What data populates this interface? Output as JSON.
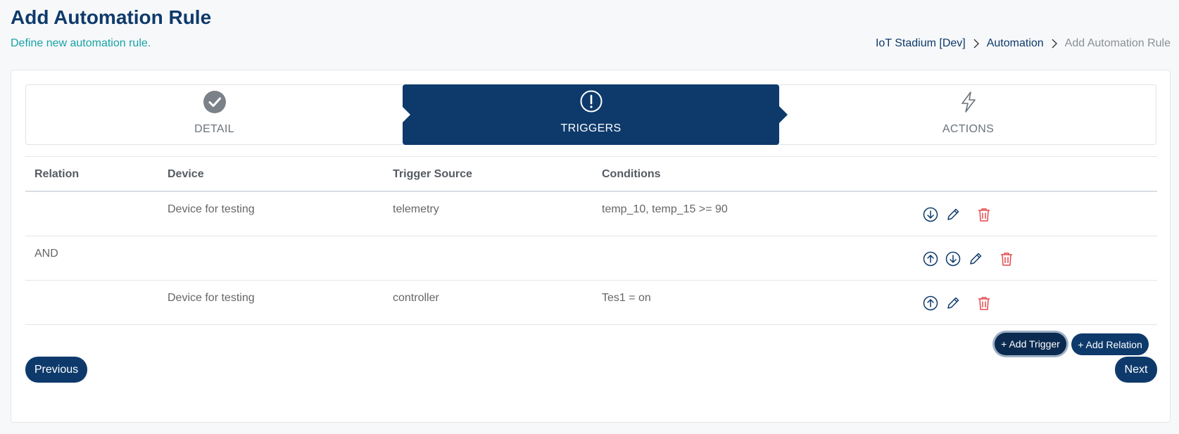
{
  "header": {
    "title": "Add Automation Rule",
    "subtitle": "Define new automation rule."
  },
  "breadcrumb": [
    "IoT Stadium [Dev]",
    "Automation",
    "Add Automation Rule"
  ],
  "stepper": {
    "steps": [
      {
        "label": "DETAIL",
        "icon": "check-circle-icon",
        "state": "completed"
      },
      {
        "label": "TRIGGERS",
        "icon": "exclamation-circle-icon",
        "state": "active"
      },
      {
        "label": "ACTIONS",
        "icon": "lightning-icon",
        "state": "pending"
      }
    ]
  },
  "table": {
    "columns": [
      "Relation",
      "Device",
      "Trigger Source",
      "Conditions"
    ],
    "rows": [
      {
        "relation": "",
        "device": "Device for testing",
        "source": "telemetry",
        "conditions": "temp_10, temp_15 >= 90",
        "actions": [
          "move-down",
          "edit",
          "delete"
        ]
      },
      {
        "relation": "AND",
        "device": "",
        "source": "",
        "conditions": "",
        "actions": [
          "move-up",
          "move-down",
          "edit",
          "delete"
        ]
      },
      {
        "relation": "",
        "device": "Device for testing",
        "source": "controller",
        "conditions": "Tes1 = on",
        "actions": [
          "move-up",
          "edit",
          "delete"
        ]
      }
    ]
  },
  "buttons": {
    "add_trigger": "+ Add Trigger",
    "add_relation": "+ Add Relation",
    "previous": "Previous",
    "next": "Next"
  },
  "colors": {
    "primary": "#0e3a6b",
    "accent": "#17a2a6",
    "danger": "#e5484d"
  }
}
